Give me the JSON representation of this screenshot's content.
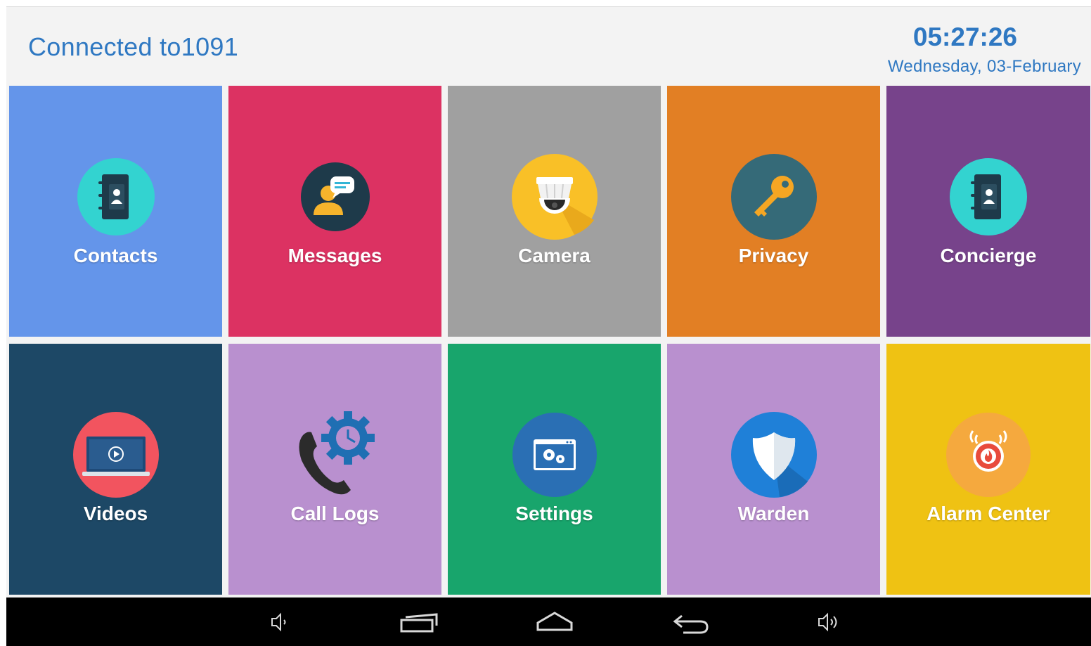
{
  "header": {
    "connection": "Connected to1091",
    "time": "05:27:26",
    "date": "Wednesday, 03-February"
  },
  "colors": {
    "accent": "#2f78c2",
    "contacts": "#6495ea",
    "messages": "#dc3262",
    "camera": "#a0a0a0",
    "privacy": "#e27f24",
    "concierge": "#77438b",
    "videos": "#1d4866",
    "call_logs": "#b990cf",
    "settings": "#18a56c",
    "warden": "#b990cf",
    "alarm_center": "#efc213",
    "navbar": "#000000"
  },
  "tiles": [
    {
      "label": "Contacts",
      "icon": "address-book-icon"
    },
    {
      "label": "Messages",
      "icon": "chat-user-icon"
    },
    {
      "label": "Camera",
      "icon": "security-camera-icon"
    },
    {
      "label": "Privacy",
      "icon": "key-icon"
    },
    {
      "label": "Concierge",
      "icon": "address-book-icon"
    },
    {
      "label": "Videos",
      "icon": "video-laptop-icon"
    },
    {
      "label": "Call Logs",
      "icon": "phone-gear-icon"
    },
    {
      "label": "Settings",
      "icon": "settings-window-icon"
    },
    {
      "label": "Warden",
      "icon": "shield-icon"
    },
    {
      "label": "Alarm Center",
      "icon": "fire-alarm-icon"
    }
  ],
  "navbar": {
    "buttons": [
      "volume-down-icon",
      "recent-apps-icon",
      "home-icon",
      "back-icon",
      "volume-up-icon"
    ]
  }
}
